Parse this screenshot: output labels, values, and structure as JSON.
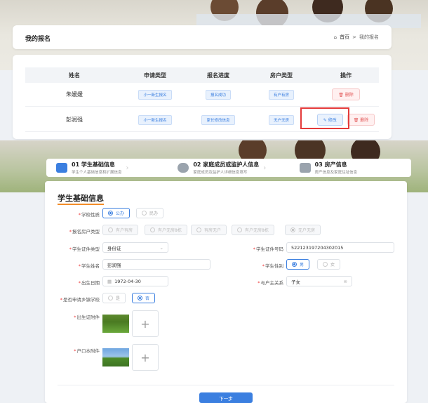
{
  "header": {
    "title": "我的报名",
    "breadcrumb_home": "首页",
    "breadcrumb_sep": ">",
    "breadcrumb_current": "我的报名"
  },
  "table": {
    "columns": [
      "姓名",
      "申请类型",
      "报名进度",
      "房户类型",
      "操作"
    ],
    "rows": [
      {
        "name": "朱媛媛",
        "apply_type": "小一新生报名",
        "progress": "报名成功",
        "house_type": "有户有房",
        "delete": "删除"
      },
      {
        "name": "彭润强",
        "apply_type": "小一新生报名",
        "progress": "家长修改信息",
        "house_type": "无户无房",
        "edit": "修改",
        "delete": "删除"
      }
    ]
  },
  "steps": [
    {
      "title": "01 学生基础信息",
      "subtitle": "学生个人基础信息和扩展信息"
    },
    {
      "title": "02 家庭成员或监护人信息",
      "subtitle": "家庭成员及监护人详细信息填写"
    },
    {
      "title": "03 房产信息",
      "subtitle": "房产信息及家庭住址信息"
    }
  ],
  "form": {
    "section_title": "学生基础信息",
    "school_nature": {
      "label": "学校性质",
      "options": [
        "公办",
        "民办"
      ]
    },
    "house_type": {
      "label": "报名房户类型",
      "options": [
        "有户有房",
        "有户无房8栋",
        "有房无户",
        "有户无房8栋",
        "无户无房"
      ]
    },
    "id_type": {
      "label": "学生证件类型",
      "value": "身份证"
    },
    "id_number": {
      "label": "学生证件号码",
      "value": "522123197204302015"
    },
    "student_name": {
      "label": "学生姓名",
      "value": "彭润强"
    },
    "gender": {
      "label": "学生性别",
      "options": [
        "男",
        "女"
      ]
    },
    "birthday": {
      "label": "出生日期",
      "value": "1972-04-30"
    },
    "relation": {
      "label": "与户主关系",
      "value": "子女"
    },
    "township": {
      "label": "是否申请乡镇学校",
      "options": [
        "是",
        "否"
      ]
    },
    "birth_cert": {
      "label": "出生证附件"
    },
    "household": {
      "label": "户口本附件"
    },
    "next_label": "下一步"
  },
  "colors": {
    "primary": "#3b7fe0",
    "danger": "#e25a5a",
    "accent": "#f28c28",
    "highlight": "#e43a3a"
  }
}
